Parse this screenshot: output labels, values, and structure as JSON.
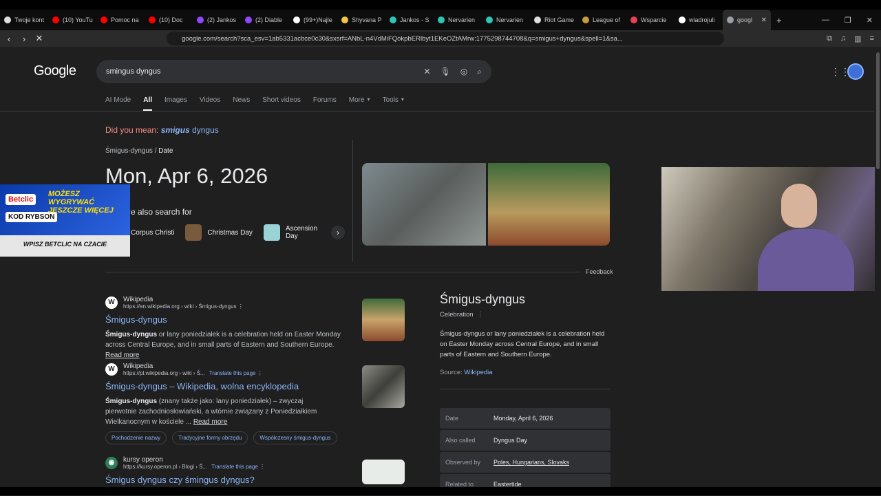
{
  "browser": {
    "tabs": [
      {
        "label": "Twoje kont",
        "color": "#e0e0e0"
      },
      {
        "label": "(10) YouTu",
        "color": "#ff0000"
      },
      {
        "label": "Pomoc na",
        "color": "#ff0000"
      },
      {
        "label": "(10) Doc",
        "color": "#ff0000"
      },
      {
        "label": "(2) Jankos",
        "color": "#9146ff"
      },
      {
        "label": "(2) Diable",
        "color": "#9146ff"
      },
      {
        "label": "(99+)Najle",
        "color": "#ffffff"
      },
      {
        "label": "Shyvana P",
        "color": "#f4c542"
      },
      {
        "label": "Jankos - S",
        "color": "#2ec4b6"
      },
      {
        "label": "Nervarien",
        "color": "#2ec4b6"
      },
      {
        "label": "Nervarien",
        "color": "#2ec4b6"
      },
      {
        "label": "Riot Game",
        "color": "#e0e0e0"
      },
      {
        "label": "League of",
        "color": "#c89b3c"
      },
      {
        "label": "Wsparcie",
        "color": "#e84057"
      },
      {
        "label": "wiadrojuli",
        "color": "#ffffff"
      },
      {
        "label": "googl",
        "color": "#9aa0a6",
        "active": true
      }
    ],
    "url": "google.com/search?sca_esv=1ab5331acbce0c30&sxsrf=ANbL-n4VdMiFQokpbERlbyt1EKeOZtAMrw:1775298744708&q=smigus+dyngus&spell=1&sa..."
  },
  "search": {
    "logo": "Google",
    "query": "smingus dyngus",
    "tabs": [
      "AI Mode",
      "All",
      "Images",
      "Videos",
      "News",
      "Short videos",
      "Forums",
      "More",
      "Tools"
    ],
    "active_tab": "All"
  },
  "spell": {
    "prefix": "Did you mean: ",
    "corrected_bold": "smigus",
    "corrected_rest": " dyngus"
  },
  "featured": {
    "breadcrumb_entity": "Śmigus-dyngus",
    "breadcrumb_attr": "Date",
    "date": "Mon, Apr 6, 2026",
    "also_search_label": "e also search for",
    "also_items": [
      "Corpus Christi",
      "Christmas Day",
      "Ascension Day"
    ],
    "feedback": "Feedback"
  },
  "ad": {
    "brand": "Betclic",
    "code": "KOD RYBSON",
    "promo": "MOŻESZ WYGRYWAĆ JESZCZE WIĘCEJ",
    "footer": "WPISZ BETCLIC NA CZACIE"
  },
  "results": [
    {
      "site": "Wikipedia",
      "icon": "W",
      "url": "https://en.wikipedia.org › wiki › Śmigus-dyngus",
      "translate": "",
      "title": "Śmigus-dyngus",
      "snippet_bold": "Śmigus-dyngus",
      "snippet": " or lany poniedziałek is a celebration held on Easter Monday across Central Europe, and in small parts of Eastern and Southern Europe.",
      "read_more": "Read more"
    },
    {
      "site": "Wikipedia",
      "icon": "W",
      "url": "https://pl.wikipedia.org › wiki › Ś...",
      "translate": "Translate this page",
      "title": "Śmigus-dyngus – Wikipedia, wolna encyklopedia",
      "snippet_bold": "Śmigus-dyngus",
      "snippet": " (znany także jako: lany poniedziałek) – zwyczaj pierwotnie zachodniosłowiański, a wtórnie związany z Poniedziałkiem Wielkanocnym w kościele ...",
      "read_more": "Read more",
      "pills": [
        "Pochodzenie nazwy",
        "Tradycyjne formy obrzędu",
        "Współczesny śmigus-dyngus"
      ]
    },
    {
      "site": "kursy operon",
      "icon": "",
      "url": "https://kursy.operon.pl › Blogi › Ś...",
      "translate": "Translate this page",
      "title": "Śmigus dyngus czy śmingus dyngus?"
    }
  ],
  "knowledge_panel": {
    "title": "Śmigus-dyngus",
    "subtitle": "Celebration",
    "description": "Śmigus-dyngus or lany poniedziałek is a celebration held on Easter Monday across Central Europe, and in small parts of Eastern and Southern Europe.",
    "source_label": "Source: ",
    "source_link": "Wikipedia",
    "facts": [
      {
        "key": "Date",
        "value": "Monday, April 6, 2026"
      },
      {
        "key": "Also called",
        "value": "Dyngus Day"
      },
      {
        "key": "Observed by",
        "value": "Poles, Hungarians, Slovaks"
      },
      {
        "key": "Related to",
        "value": "Eastertide"
      }
    ]
  }
}
